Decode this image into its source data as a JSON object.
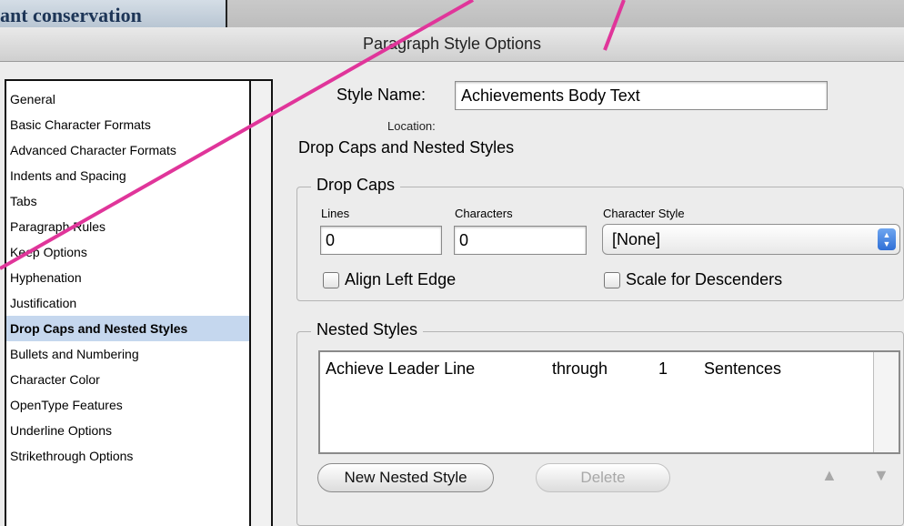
{
  "background_document": {
    "title": "ant conservation"
  },
  "dialog": {
    "title": "Paragraph Style Options"
  },
  "categories": [
    {
      "label": "General",
      "selected": false
    },
    {
      "label": "Basic Character Formats",
      "selected": false
    },
    {
      "label": "Advanced Character Formats",
      "selected": false
    },
    {
      "label": "Indents and Spacing",
      "selected": false
    },
    {
      "label": "Tabs",
      "selected": false
    },
    {
      "label": "Paragraph Rules",
      "selected": false
    },
    {
      "label": "Keep Options",
      "selected": false
    },
    {
      "label": "Hyphenation",
      "selected": false
    },
    {
      "label": "Justification",
      "selected": false
    },
    {
      "label": "Drop Caps and Nested Styles",
      "selected": true
    },
    {
      "label": "Bullets and Numbering",
      "selected": false
    },
    {
      "label": "Character Color",
      "selected": false
    },
    {
      "label": "OpenType Features",
      "selected": false
    },
    {
      "label": "Underline Options",
      "selected": false
    },
    {
      "label": "Strikethrough Options",
      "selected": false
    }
  ],
  "style_name": {
    "label": "Style Name:",
    "value": "Achievements Body Text"
  },
  "location": {
    "label": "Location:"
  },
  "section": {
    "title": "Drop Caps and Nested Styles"
  },
  "drop_caps": {
    "legend": "Drop Caps",
    "lines_label": "Lines",
    "lines_value": "0",
    "characters_label": "Characters",
    "characters_value": "0",
    "character_style_label": "Character Style",
    "character_style_value": "[None]",
    "align_left_edge_label": "Align Left Edge",
    "align_left_edge_checked": false,
    "scale_for_descenders_label": "Scale for Descenders",
    "scale_for_descenders_checked": false
  },
  "nested_styles": {
    "legend": "Nested Styles",
    "rows": [
      {
        "style": "Achieve Leader Line",
        "mode": "through",
        "count": "1",
        "unit": "Sentences"
      }
    ],
    "new_button_label": "New Nested Style",
    "delete_button_label": "Delete",
    "move_up_glyph": "▲",
    "move_down_glyph": "▼"
  },
  "colors": {
    "annotation": "#e0359a",
    "selection": "#c5d7ee",
    "doc_title": "#1d3557"
  }
}
